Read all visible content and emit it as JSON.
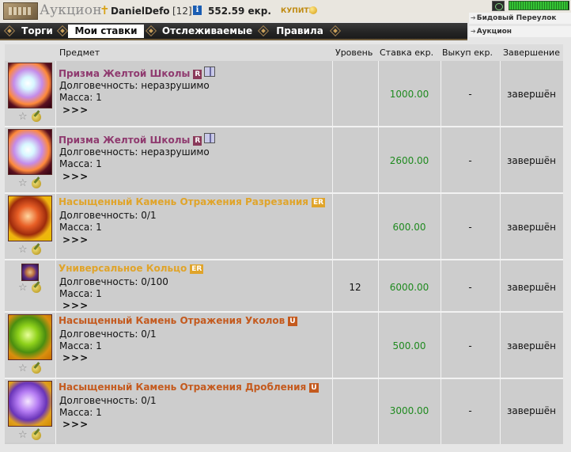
{
  "header": {
    "title": "Аукцион",
    "player_name": "DanielDefo",
    "player_level": "[12]",
    "info_badge": "i",
    "money": "552.59 екр.",
    "buy_label": "КУПИТЬ",
    "hp_fraction": 0.98
  },
  "locations": [
    {
      "label": "Бидовый Переулок"
    },
    {
      "label": "Аукцион"
    }
  ],
  "tabs": [
    {
      "label": "Торги",
      "active": false
    },
    {
      "label": "Мои ставки",
      "active": true
    },
    {
      "label": "Отслеживаемые",
      "active": false
    },
    {
      "label": "Правила",
      "active": false
    }
  ],
  "table": {
    "columns": [
      "Предмет",
      "Уровень",
      "Ставка екр.",
      "Выкуп екр.",
      "Завершение"
    ],
    "rows": [
      {
        "name": "Призма Желтой Школы",
        "badge": "R",
        "gift": true,
        "durability": "Долговечность: неразрушимо",
        "mass": "Масса: 1",
        "more": ">>>",
        "level": "",
        "bid": "1000.00",
        "buyout": "-",
        "end": "завершён",
        "icon": "prism-gem-icon"
      },
      {
        "name": "Призма Желтой Школы",
        "badge": "R",
        "gift": true,
        "durability": "Долговечность: неразрушимо",
        "mass": "Масса: 1",
        "more": ">>>",
        "level": "",
        "bid": "2600.00",
        "buyout": "-",
        "end": "завершён",
        "icon": "prism-gem-icon"
      },
      {
        "name": "Насыщенный Камень Отражения Разрезания",
        "badge": "ER",
        "gift": false,
        "durability": "Долговечность: 0/1",
        "mass": "Масса: 1",
        "more": ">>>",
        "level": "",
        "bid": "600.00",
        "buyout": "-",
        "end": "завершён",
        "icon": "red-gem-icon"
      },
      {
        "name": "Универсальное Кольцо",
        "badge": "ER",
        "gift": false,
        "durability": "Долговечность: 0/100",
        "mass": "Масса: 1",
        "more": ">>>",
        "level": "12",
        "bid": "6000.00",
        "buyout": "-",
        "end": "завершён",
        "icon": "ring-icon"
      },
      {
        "name": "Насыщенный Камень Отражения Уколов",
        "badge": "U",
        "gift": false,
        "durability": "Долговечность: 0/1",
        "mass": "Масса: 1",
        "more": ">>>",
        "level": "",
        "bid": "500.00",
        "buyout": "-",
        "end": "завершён",
        "icon": "green-gem-icon"
      },
      {
        "name": "Насыщенный Камень Отражения Дробления",
        "badge": "U",
        "gift": false,
        "durability": "Долговечность: 0/1",
        "mass": "Масса: 1",
        "more": ">>>",
        "level": "",
        "bid": "3000.00",
        "buyout": "-",
        "end": "завершён",
        "icon": "purple-gem-icon"
      }
    ]
  },
  "colors": {
    "bid_text": "#1f8a1f",
    "name_rare": "#8f3a6f",
    "name_er": "#e0a42a",
    "name_unique": "#c45a1e"
  }
}
